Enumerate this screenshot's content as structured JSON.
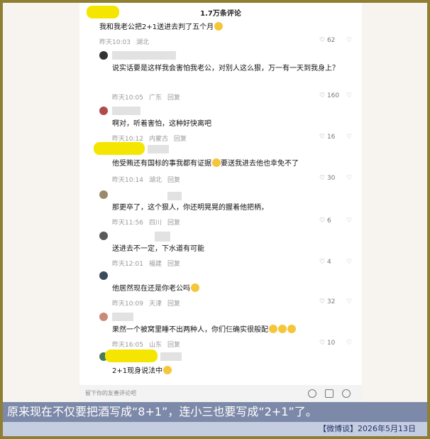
{
  "header": {
    "title": "1.7万条评论"
  },
  "comments": [
    {
      "text": "我和我老公把2+1送进去判了五个月",
      "emoji_count": 1,
      "time": "昨天10:03",
      "location": "湖北",
      "reply": "",
      "likes": "62"
    },
    {
      "text": "说实话要是这样我会害怕我老公，对别人这么狠，万一有一天到我身上？",
      "emoji_count": 0,
      "time": "昨天10:05",
      "location": "广东",
      "reply": "回复",
      "likes": "160"
    },
    {
      "text": "啊对，听着害怕，这种好快离吧",
      "emoji_count": 0,
      "time": "昨天10:12",
      "location": "内蒙古",
      "reply": "回复",
      "likes": "16"
    },
    {
      "text_a": "他受贿还有国标的事我都有证据",
      "text_b": "要送我进去他也幸免不了",
      "time": "昨天10:14",
      "location": "湖北",
      "reply": "回复",
      "likes": "30"
    },
    {
      "text": "那更卒了，这个狠人，你还明晃晃的握着他把柄，",
      "emoji_count": 0,
      "time": "昨天11:56",
      "location": "四川",
      "reply": "回复",
      "likes": "6"
    },
    {
      "text": "送进去不一定，下水道有可能",
      "emoji_count": 0,
      "time": "昨天12:01",
      "location": "福建",
      "reply": "回复",
      "likes": "4"
    },
    {
      "text": "他居然现在还是你老公吗",
      "emoji_count": 1,
      "time": "昨天10:09",
      "location": "天津",
      "reply": "回复",
      "likes": "32"
    },
    {
      "text": "果然一个被窝里睡不出两种人，你们仨确实很般配",
      "emoji_count": 3,
      "time": "昨天16:05",
      "location": "山东",
      "reply": "回复",
      "likes": "10"
    },
    {
      "text": "2+1现身说法中",
      "emoji_count": 1,
      "time": "",
      "location": "",
      "reply": "",
      "likes": ""
    }
  ],
  "input": {
    "placeholder": "留下你的友善评论吧"
  },
  "caption": "原来现在不仅要把酒写成“8+1”，连小三也要写成“2+1”了。",
  "credit": "【微博谈】2026年5月13日",
  "colors": {
    "highlight": "#f4e600",
    "caption_bg": "#7c89a8",
    "credit_bg": "#c5cde0",
    "frame": "#8f7f33"
  }
}
